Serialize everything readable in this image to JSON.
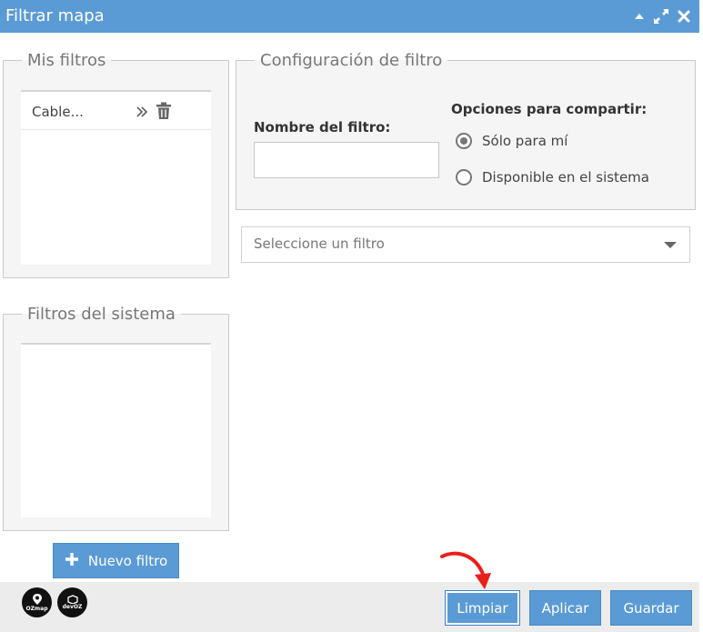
{
  "window": {
    "title": "Filtrar mapa"
  },
  "mis_filtros": {
    "legend": "Mis filtros",
    "items": [
      {
        "name": "Cable..."
      }
    ]
  },
  "filtros_sistema": {
    "legend": "Filtros del sistema"
  },
  "configuracion": {
    "legend": "Configuración de filtro",
    "nombre_label": "Nombre del filtro:",
    "nombre_value": "",
    "opciones_label": "Opciones para compartir:",
    "opciones": [
      {
        "label": "Sólo para mí",
        "selected": true
      },
      {
        "label": "Disponible en el sistema",
        "selected": false
      }
    ]
  },
  "selector": {
    "placeholder": "Seleccione un filtro"
  },
  "buttons": {
    "nuevo": "Nuevo filtro",
    "limpiar": "Limpiar",
    "aplicar": "Aplicar",
    "guardar": "Guardar"
  },
  "logos": {
    "first": "OZmap",
    "second": "devOZ"
  },
  "colors": {
    "accent": "#5b9bd5",
    "annotation_arrow": "#e8201a"
  }
}
